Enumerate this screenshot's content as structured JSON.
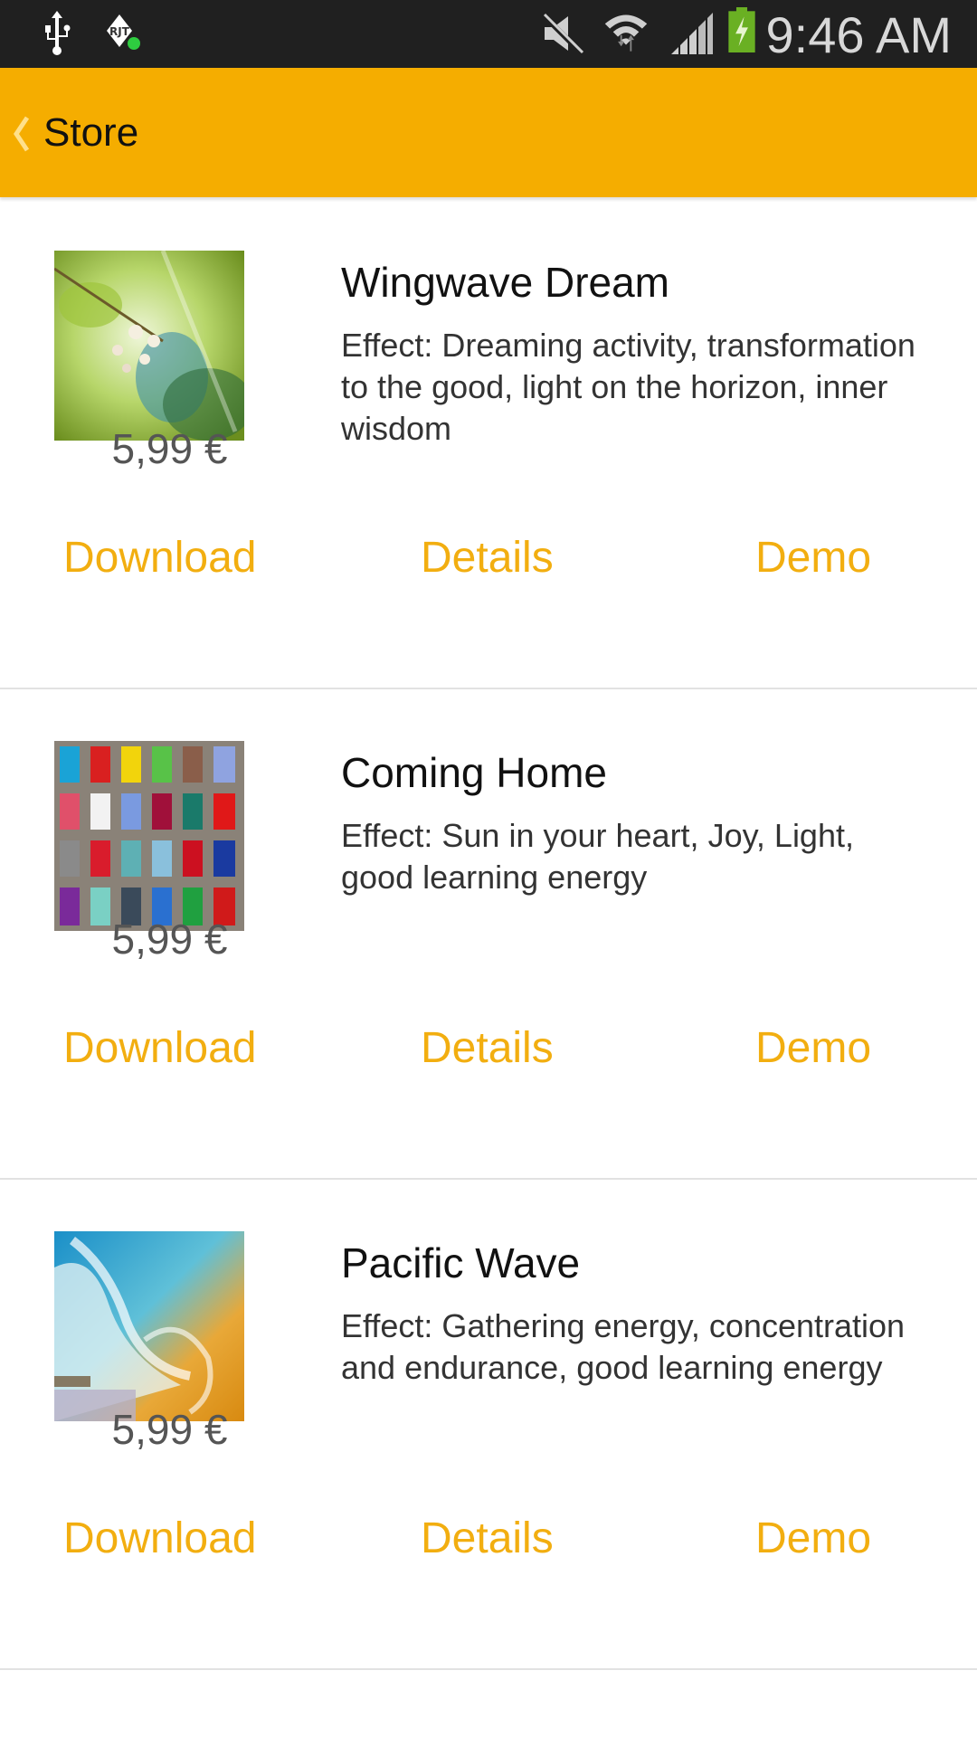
{
  "status_bar": {
    "time": "9:46 AM",
    "icons": [
      "usb-icon",
      "app-notification-icon",
      "mute-icon",
      "wifi-icon",
      "signal-icon",
      "battery-charging-icon"
    ]
  },
  "action_bar": {
    "back_icon": "chevron-left-icon",
    "title": "Store",
    "color": "#F5AD00"
  },
  "accent_color": "#F2AE10",
  "items": [
    {
      "title": "Wingwave Dream",
      "description": "Effect: Dreaming activity, transformation to the good, light on the horizon, inner wisdom",
      "price": "5,99 €",
      "image": "blossom-branch-thumbnail",
      "buttons": {
        "download": "Download",
        "details": "Details",
        "demo": "Demo"
      }
    },
    {
      "title": "Coming Home",
      "description": "Effect: Sun in your heart, Joy, Light, good learning energy",
      "price": "5,99 €",
      "image": "colorful-doors-thumbnail",
      "buttons": {
        "download": "Download",
        "details": "Details",
        "demo": "Demo"
      }
    },
    {
      "title": "Pacific Wave",
      "description": "Effect: Gathering energy, concentration and endurance, good learning energy",
      "price": "5,99 €",
      "image": "ocean-wave-thumbnail",
      "buttons": {
        "download": "Download",
        "details": "Details",
        "demo": "Demo"
      }
    }
  ]
}
